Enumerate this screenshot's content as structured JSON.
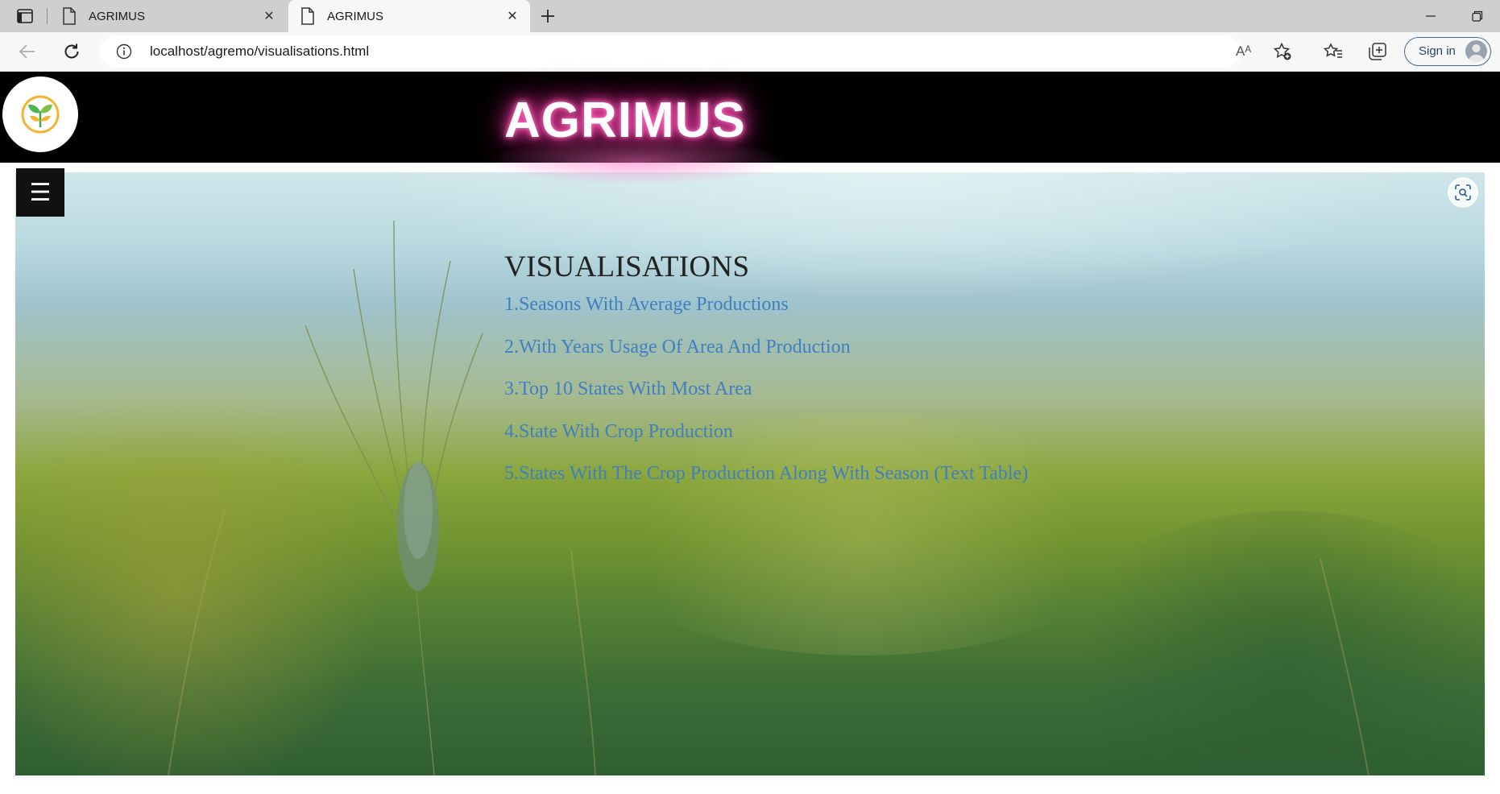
{
  "browser": {
    "tabs": [
      {
        "title": "AGRIMUS",
        "active": false
      },
      {
        "title": "AGRIMUS",
        "active": true
      }
    ],
    "url": "localhost/agremo/visualisations.html",
    "sign_in_label": "Sign in",
    "read_aloud_glyph": "Aᴬ",
    "close_glyph": "✕"
  },
  "site": {
    "brand": "AGRIMUS",
    "menu_glyph": "☰"
  },
  "main": {
    "heading": "VISUALISATIONS",
    "links": [
      "1.Seasons With Average Productions",
      "2.With Years Usage Of Area And Production",
      "3.Top 10 States With Most Area",
      "4.State With Crop Production",
      "5.States With The Crop Production Along With Season (Text Table)"
    ]
  },
  "colors": {
    "brand_glow": "#ff4fb4",
    "link": "#3f7fc2",
    "header_bg": "#000000"
  }
}
